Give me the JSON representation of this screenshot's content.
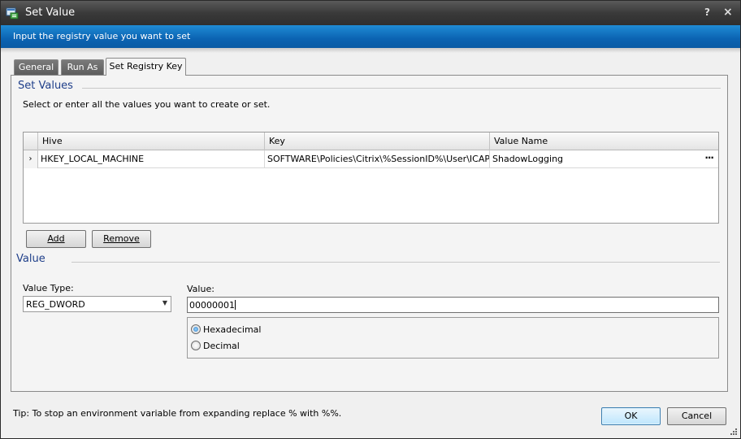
{
  "window": {
    "title": "Set Value",
    "help_glyph": "?",
    "close_glyph": "×"
  },
  "banner": {
    "text": "Input the registry value you want to set"
  },
  "tabs": [
    {
      "label": "General"
    },
    {
      "label": "Run As"
    },
    {
      "label": "Set Registry Key",
      "active": true
    }
  ],
  "set_values": {
    "title": "Set Values",
    "instruction": "Select or enter all the values you want to create or set.",
    "grid": {
      "columns": [
        "Hive",
        "Key",
        "Value Name"
      ],
      "rows": [
        {
          "indicator": "›",
          "hive": "HKEY_LOCAL_MACHINE",
          "key": "SOFTWARE\\Policies\\Citrix\\%SessionID%\\User\\ICAPoli...",
          "value_name": "ShadowLogging",
          "ellipsis": "···"
        }
      ]
    },
    "add_label": "Add",
    "remove_label": "Remove"
  },
  "value": {
    "title": "Value",
    "type_label": "Value Type:",
    "type_selected": "REG_DWORD",
    "combo_arrow": "▼",
    "value_label": "Value:",
    "value_text": "00000001",
    "radios": [
      {
        "label": "Hexadecimal",
        "checked": true
      },
      {
        "label": "Decimal",
        "checked": false
      }
    ]
  },
  "footer": {
    "tip": "Tip: To stop an environment variable from expanding replace % with %%.",
    "ok_label": "OK",
    "cancel_label": "Cancel"
  },
  "colors": {
    "banner": "#0b63b2",
    "group_title": "#1f3f8a",
    "titlebar": "#3a3a3a"
  }
}
